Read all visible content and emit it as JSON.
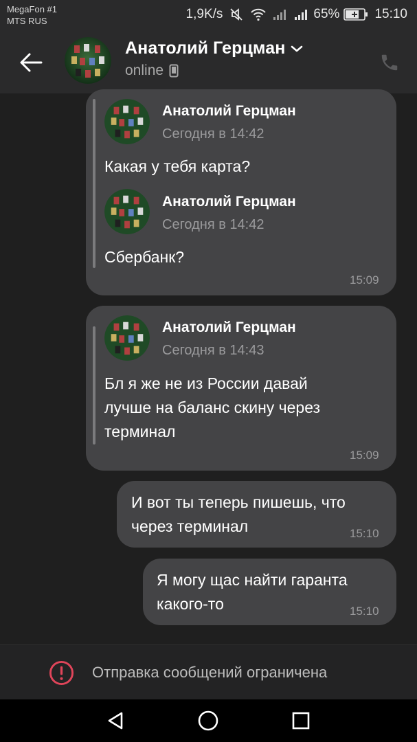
{
  "status_bar": {
    "carrier_line1": "MegaFon #1",
    "carrier_line2": "MTS RUS",
    "network_speed": "1,9K/s",
    "battery_percent": "65%",
    "time": "15:10",
    "icons": [
      "mute-icon",
      "wifi-icon",
      "signal-icon",
      "signal-icon",
      "battery-icon"
    ]
  },
  "header": {
    "contact_name": "Анатолий Герцман",
    "status": "online",
    "icons": [
      "back-arrow-icon",
      "chevron-down-icon",
      "mobile-device-icon",
      "phone-icon"
    ]
  },
  "messages": [
    {
      "forwards": [
        {
          "name": "Анатолий Герцман",
          "date": "Сегодня в 14:42",
          "text": "Какая у тебя карта?"
        },
        {
          "name": "Анатолий Герцман",
          "date": "Сегодня в 14:42",
          "text": "Сбербанк?"
        }
      ],
      "time": "15:09"
    },
    {
      "forwards": [
        {
          "name": "Анатолий Герцман",
          "date": "Сегодня в 14:43",
          "text_lines": [
            "Бл я же не из России давай",
            "лучше на баланс скину через",
            "терминал"
          ]
        }
      ],
      "time": "15:09"
    },
    {
      "text_lines": [
        "И вот ты теперь пишешь, что",
        "через терминал"
      ],
      "time": "15:10"
    },
    {
      "text_lines": [
        "Я могу щас найти гаранта",
        "какого-то"
      ],
      "time": "15:10"
    }
  ],
  "restriction": {
    "text": "Отправка сообщений ограничена",
    "icon": "warning-icon"
  },
  "nav_bar": {
    "icons": [
      "back-triangle-icon",
      "home-circle-icon",
      "recents-square-icon"
    ]
  },
  "colors": {
    "background": "#1f1f1f",
    "header": "#2a2a2b",
    "bubble": "#444446",
    "warning": "#e0455a"
  }
}
